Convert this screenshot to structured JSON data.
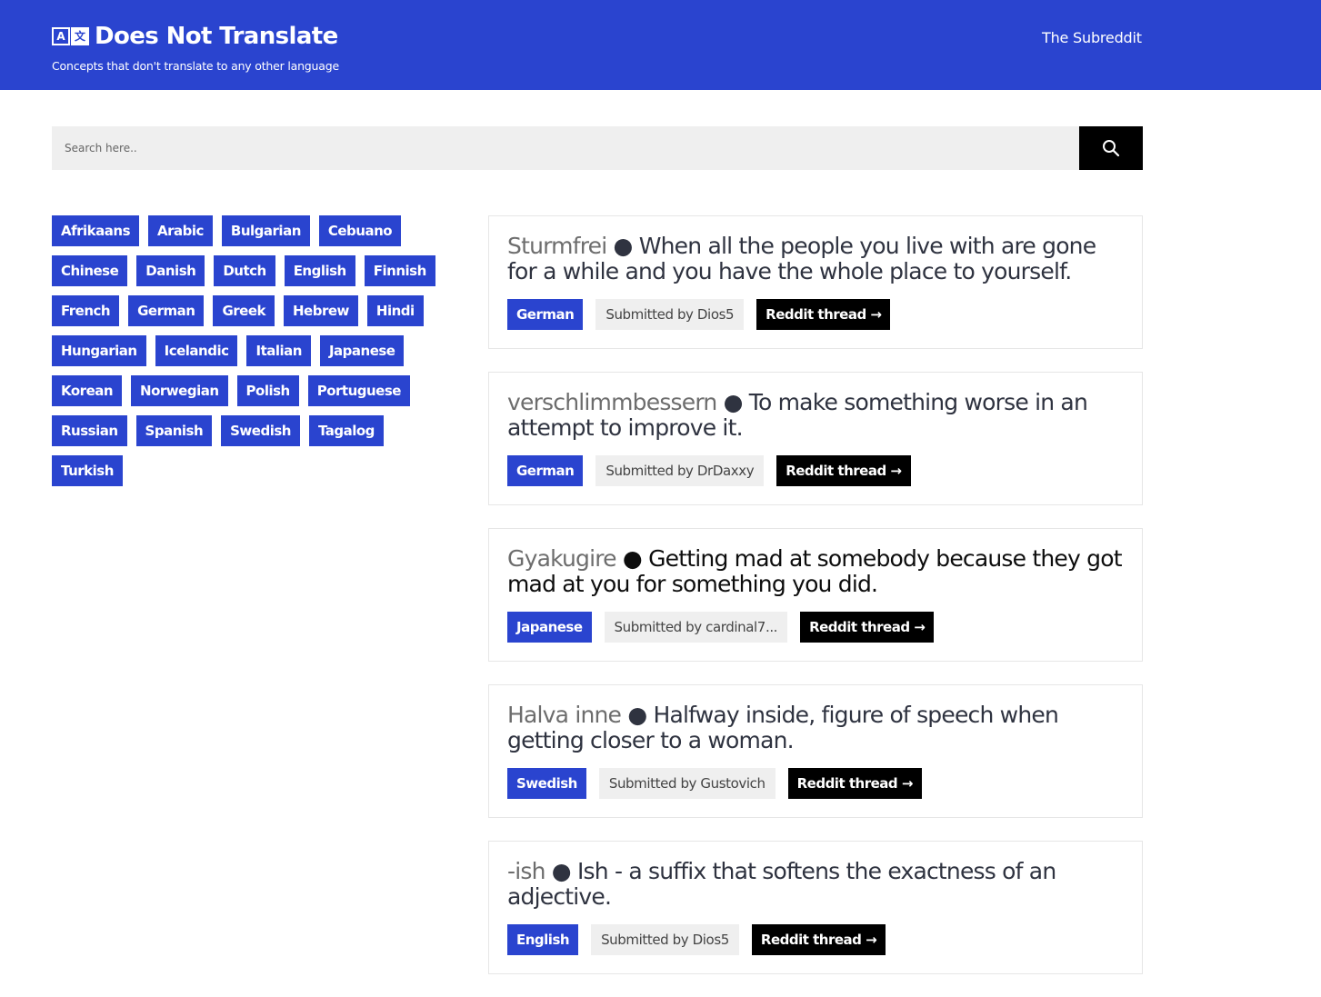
{
  "header": {
    "brand_icon_left": "A",
    "brand_icon_right": "文",
    "title": "Does Not Translate",
    "tagline": "Concepts that don't translate to any other language",
    "nav_link": "The Subreddit",
    "background_color": "#2a44cf"
  },
  "search": {
    "placeholder": "Search here..",
    "button_icon": "search-icon"
  },
  "languages": [
    [
      "Afrikaans",
      "Arabic",
      "Bulgarian",
      "Cebuano"
    ],
    [
      "Chinese",
      "Danish",
      "Dutch",
      "English",
      "Finnish"
    ],
    [
      "French",
      "German",
      "Greek",
      "Hebrew",
      "Hindi"
    ],
    [
      "Hungarian",
      "Icelandic",
      "Italian",
      "Japanese"
    ],
    [
      "Korean",
      "Norwegian",
      "Polish",
      "Portuguese"
    ],
    [
      "Russian",
      "Spanish",
      "Swedish",
      "Tagalog"
    ],
    [
      "Turkish"
    ]
  ],
  "entries": [
    {
      "word": "Sturmfrei",
      "bullet": "●",
      "meaning": "When all the people you live with are gone for a while and you have the whole place to yourself.",
      "language": "German",
      "submitted": "Submitted by Dios5",
      "link": "Reddit thread →"
    },
    {
      "word": "verschlimmbessern",
      "bullet": "●",
      "meaning": "To make something worse in an attempt to improve it.",
      "language": "German",
      "submitted": "Submitted by DrDaxxy",
      "link": "Reddit thread →"
    },
    {
      "word": "Gyakugire",
      "bullet": "●",
      "meaning": "Getting mad at somebody because they got mad at you for something you did.",
      "language": "Japanese",
      "submitted": "Submitted by cardinal7...",
      "link": "Reddit thread →"
    },
    {
      "word": "Halva inne",
      "bullet": "●",
      "meaning": "Halfway inside, figure of speech when getting closer to a woman.",
      "language": "Swedish",
      "submitted": "Submitted by Gustovich",
      "link": "Reddit thread →"
    },
    {
      "word": "-ish",
      "bullet": "●",
      "meaning": "Ish - a suffix that softens the exactness of an adjective.",
      "language": "English",
      "submitted": "Submitted by Dios5",
      "link": "Reddit thread →"
    }
  ]
}
